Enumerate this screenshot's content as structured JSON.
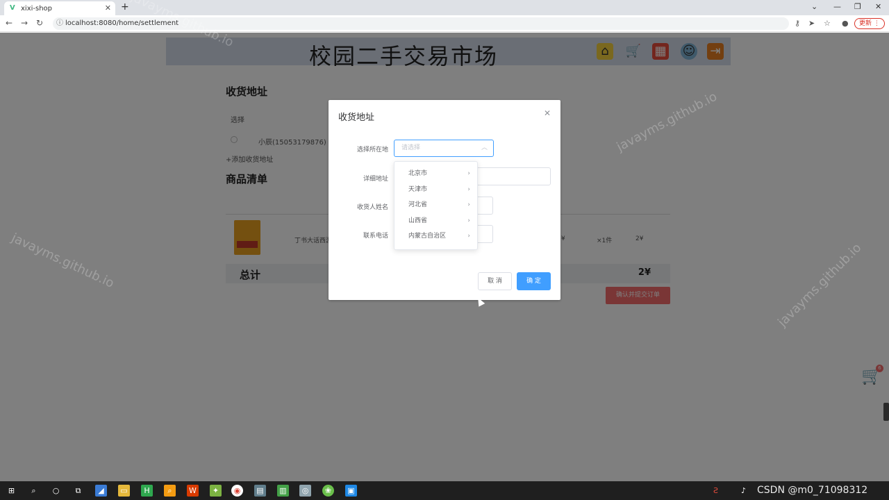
{
  "browser": {
    "tab_title": "xixi-shop",
    "url": "localhost:8080/home/settlement",
    "update_label": "更新"
  },
  "page": {
    "site_title": "校园二手交易市场",
    "address_heading": "收货地址",
    "select_label": "选择",
    "address_item": "小辰(15053179876)",
    "add_address_link": "+添加收货地址",
    "goods_heading": "商品清单",
    "item_name": "丁书大话西游",
    "item_price": "¥",
    "item_qty": "×1件",
    "item_subtotal": "2¥",
    "total_label": "总计",
    "total_value": "2¥",
    "submit_label": "确认并提交订单",
    "cart_badge": "6"
  },
  "dialog": {
    "title": "收货地址",
    "region_label": "选择所在地",
    "region_placeholder": "请选择",
    "detail_label": "详细地址",
    "name_label": "收货人姓名",
    "phone_label": "联系电话",
    "cancel_label": "取 消",
    "confirm_label": "确 定",
    "provinces": [
      "北京市",
      "天津市",
      "河北省",
      "山西省",
      "内蒙古自治区"
    ]
  },
  "watermark": "javayms.github.io",
  "taskbar": {
    "csdn_text": "CSDN @m0_71098312"
  }
}
